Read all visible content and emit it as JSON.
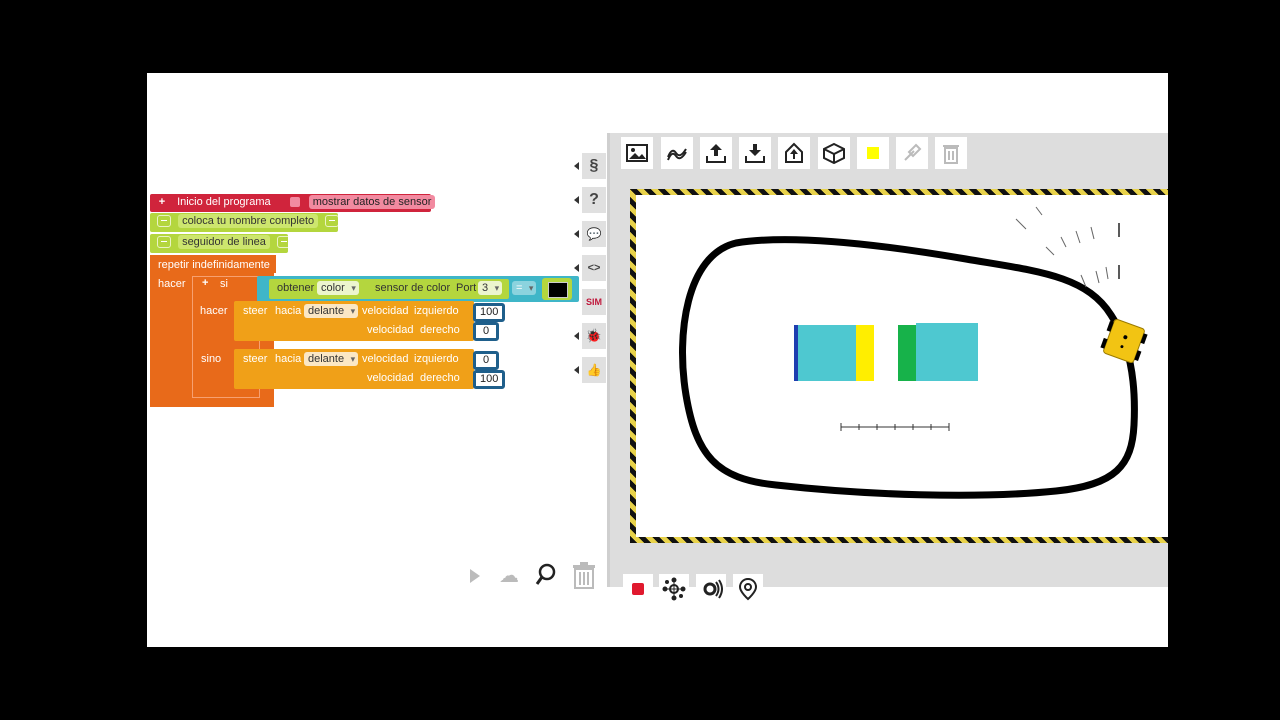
{
  "program": {
    "start_label": "Inicio del programa",
    "show_sensor_label": "mostrar datos de sensor",
    "name_block": "coloca tu nombre completo",
    "line_follower": "seguidor de linea",
    "repeat_label": "repetir indefinidamente",
    "do_label": "hacer",
    "if_label": "si",
    "get_label": "obtener",
    "color_dropdown": "color",
    "sensor_label": "sensor de color",
    "port_label": "Port",
    "port_value": "3",
    "equals": "=",
    "then_label": "hacer",
    "else_label": "sino",
    "steer_1": {
      "steer": "steer",
      "direction_label": "hacia",
      "direction": "delante",
      "speed_label": "velocidad",
      "left_label": "izquierdo",
      "left_value": "100",
      "right_label": "derecho",
      "right_value": "0"
    },
    "steer_2": {
      "steer": "steer",
      "direction_label": "hacia",
      "direction": "delante",
      "speed_label": "velocidad",
      "left_label": "izquierdo",
      "left_value": "0",
      "right_label": "derecho",
      "right_value": "100"
    }
  },
  "categories": [
    {
      "icon": "§",
      "name": "variables-icon"
    },
    {
      "icon": "?",
      "name": "help-icon"
    },
    {
      "icon": "💬",
      "name": "comment-icon"
    },
    {
      "icon": "<>",
      "name": "code-icon"
    },
    {
      "icon": "SIM",
      "name": "sim-icon"
    },
    {
      "icon": "🐞",
      "name": "debug-icon"
    },
    {
      "icon": "👍",
      "name": "feedback-icon"
    }
  ],
  "colors": {
    "start_block": "#d0243c",
    "name_block": "#b4d63e",
    "loop_block": "#e86a1a",
    "if_block": "#e86a1a",
    "sensor_block": "#3fb6c8",
    "sensor_inner": "#b4d63e",
    "steer_block": "#f0a018",
    "field_color_black": "#000000",
    "sim_yellow": "#ffff00",
    "robot": "#f2c413",
    "obstacle_cyan": "#4ec8d0",
    "obstacle_blue": "#1e3eb0",
    "obstacle_yellow": "#ffee00",
    "obstacle_green": "#17b24a"
  },
  "sim_toolbar": [
    "image-icon",
    "path-icon",
    "export-icon",
    "import-icon",
    "upload-icon",
    "cube-icon",
    "yellow-color-swatch",
    "eyedropper-icon",
    "trash-icon"
  ],
  "sim_bottom": [
    "stop-icon",
    "network-icon",
    "sound-icon",
    "location-icon"
  ],
  "workspace_bottom": [
    "play-icon",
    "cloud-icon",
    "zoom-icon",
    "trash-icon"
  ]
}
